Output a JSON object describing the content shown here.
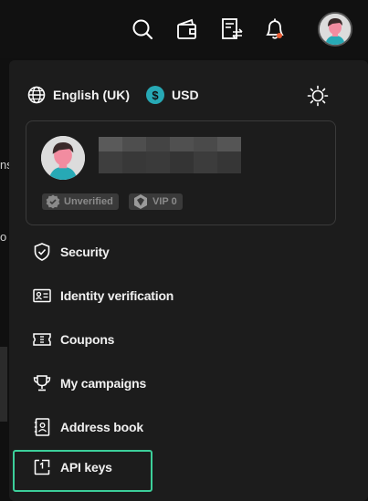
{
  "header": {
    "icons": [
      "search-icon",
      "wallet-icon",
      "orders-icon",
      "bell-icon"
    ],
    "has_notification": true
  },
  "background_fragments": [
    "ns",
    "o"
  ],
  "settings": {
    "language_label": "English (UK)",
    "currency_label": "USD",
    "currency_symbol": "$",
    "theme_icon": "sun-icon"
  },
  "profile": {
    "verification_badge": "Unverified",
    "vip_badge": "VIP 0"
  },
  "menu": {
    "items": [
      {
        "label": "Security",
        "icon": "shield-icon"
      },
      {
        "label": "Identity verification",
        "icon": "id-card-icon"
      },
      {
        "label": "Coupons",
        "icon": "ticket-icon"
      },
      {
        "label": "My campaigns",
        "icon": "trophy-icon"
      },
      {
        "label": "Address book",
        "icon": "address-book-icon"
      },
      {
        "label": "API keys",
        "icon": "api-key-icon"
      }
    ],
    "selected_index": 5
  },
  "colors": {
    "accent_highlight": "#3ccf9a",
    "usd_coin": "#27a9b5",
    "notification_dot": "#e85c34",
    "panel_bg": "#1c1c1c"
  }
}
